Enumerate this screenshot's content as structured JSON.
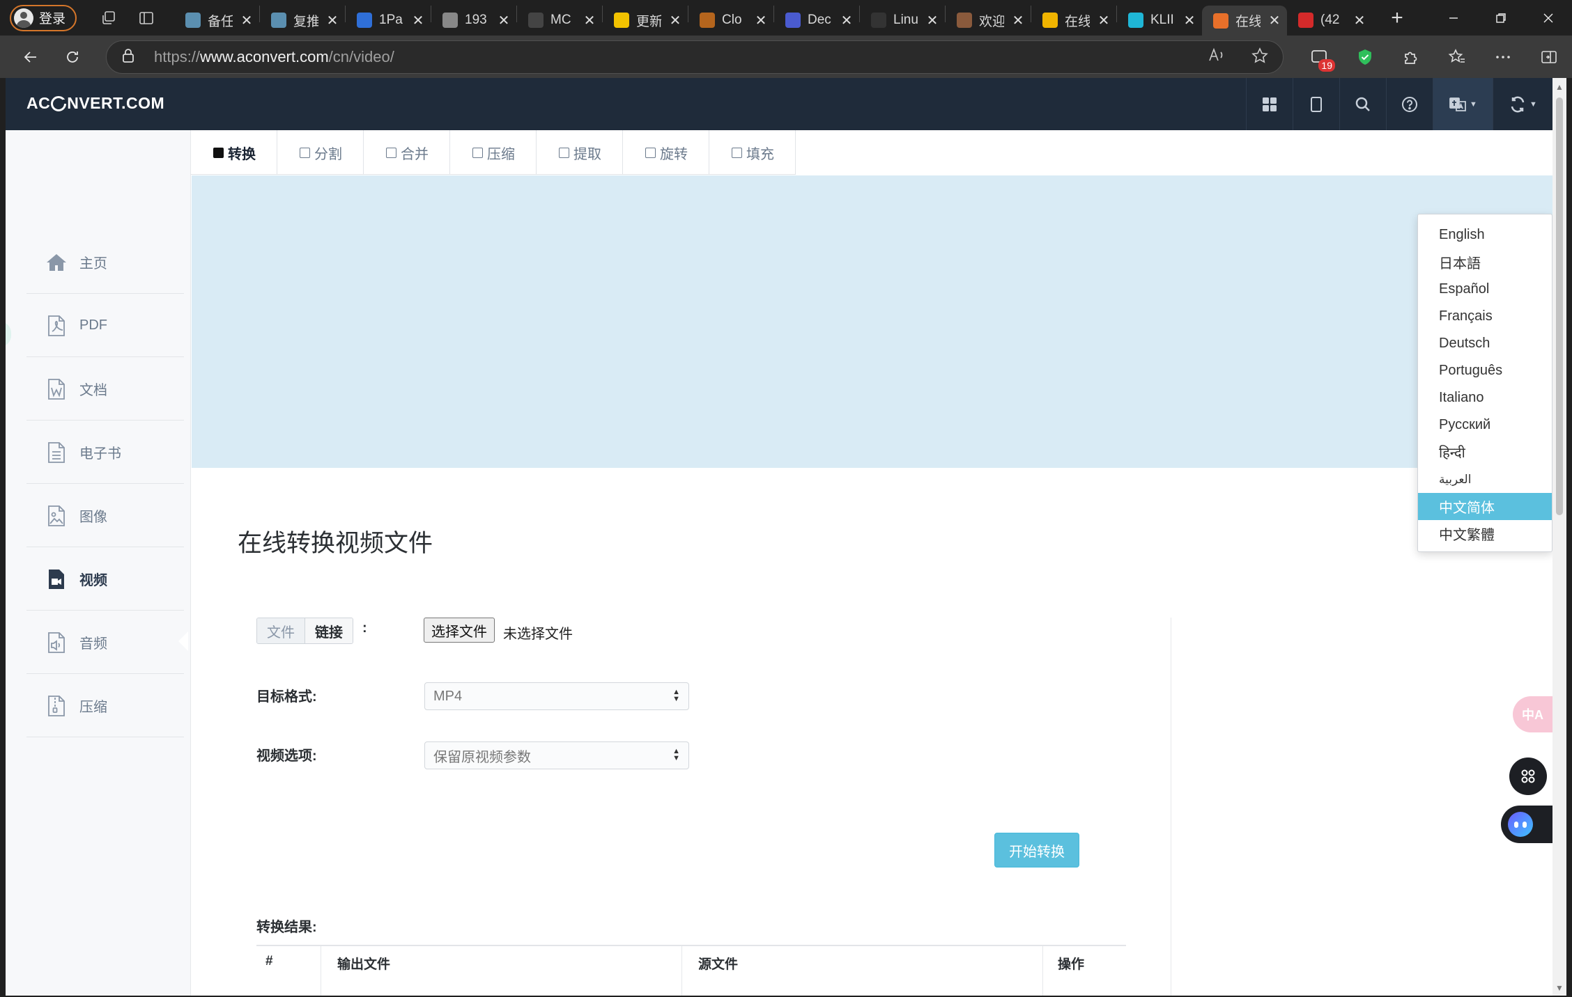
{
  "browser": {
    "profile_label": "登录",
    "tabs": [
      {
        "title": "备任",
        "color": "#5b8fb0"
      },
      {
        "title": "复推",
        "color": "#5b8fb0"
      },
      {
        "title": "1Pa",
        "color": "#2f6fd8"
      },
      {
        "title": "193",
        "color": "#888888"
      },
      {
        "title": "MC",
        "color": "#444444"
      },
      {
        "title": "更新",
        "color": "#f2c200"
      },
      {
        "title": "Clo",
        "color": "#b5651d"
      },
      {
        "title": "Dec",
        "color": "#4a5bd0"
      },
      {
        "title": "Linu",
        "color": "#333333"
      },
      {
        "title": "欢迎",
        "color": "#8a5a3c"
      },
      {
        "title": "在线",
        "color": "#f0b400"
      },
      {
        "title": "KLII",
        "color": "#1fb6d6"
      },
      {
        "title": "在线",
        "color": "#e8702a",
        "active": true
      },
      {
        "title": "(42",
        "color": "#d42a2a"
      }
    ],
    "url_prefix": "https://",
    "url_host": "www.aconvert.com",
    "url_path": "/cn/video/",
    "ext_badge": "19"
  },
  "site": {
    "logo_left": "AC",
    "logo_right": "NVERT.COM"
  },
  "sidebar": {
    "items": [
      {
        "label": "主页",
        "icon": "home-icon"
      },
      {
        "label": "PDF",
        "icon": "pdf-icon"
      },
      {
        "label": "文档",
        "icon": "word-icon"
      },
      {
        "label": "电子书",
        "icon": "ebook-icon"
      },
      {
        "label": "图像",
        "icon": "image-icon"
      },
      {
        "label": "视频",
        "icon": "video-icon",
        "active": true
      },
      {
        "label": "音频",
        "icon": "audio-icon"
      },
      {
        "label": "压缩",
        "icon": "archive-icon"
      }
    ]
  },
  "function_tabs": [
    {
      "label": "转换",
      "active": true
    },
    {
      "label": "分割"
    },
    {
      "label": "合并"
    },
    {
      "label": "压缩"
    },
    {
      "label": "提取"
    },
    {
      "label": "旋转"
    },
    {
      "label": "填充"
    }
  ],
  "main": {
    "title": "在线转换视频文件",
    "source_toggle": {
      "file": "文件",
      "link": "链接",
      "colon": ":"
    },
    "choose_file_button": "选择文件",
    "no_file_text": "未选择文件",
    "target_format_label": "目标格式:",
    "target_format_value": "MP4",
    "video_options_label": "视频选项:",
    "video_options_value": "保留原视频参数",
    "start_button": "开始转换",
    "results_label": "转换结果:",
    "table_headers": {
      "index": "#",
      "output": "输出文件",
      "source": "源文件",
      "action": "操作"
    }
  },
  "language_menu": {
    "items": [
      "English",
      "日本語",
      "Español",
      "Français",
      "Deutsch",
      "Português",
      "Italiano",
      "Русский",
      "हिन्दी",
      "العربية",
      "中文简体",
      "中文繁體"
    ],
    "selected": "中文简体"
  },
  "floating": {
    "translate_label": "中A"
  },
  "colors": {
    "header_bg": "#1f2b3a",
    "banner_bg": "#d9ebf5",
    "accent": "#5bc0de"
  }
}
